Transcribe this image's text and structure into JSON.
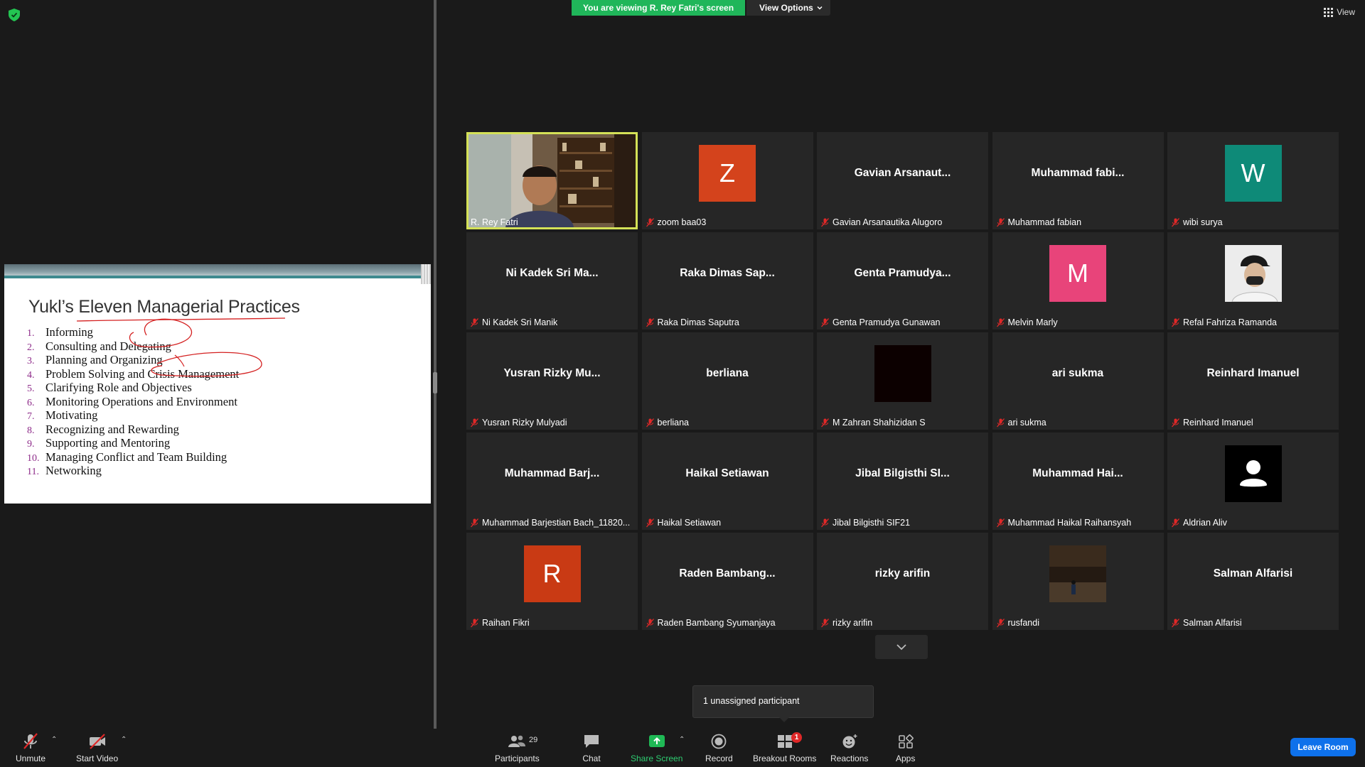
{
  "banner": {
    "viewing_text": "You are viewing R. Rey Fatri's screen",
    "view_options_label": "View Options"
  },
  "top_right": {
    "view_label": "View"
  },
  "slide": {
    "title": "Yukl’s Eleven Managerial Practices",
    "items": [
      {
        "num": "1.",
        "text": "Informing"
      },
      {
        "num": "2.",
        "text": "Consulting and Delegating"
      },
      {
        "num": "3.",
        "text": "Planning and Organizing"
      },
      {
        "num": "4.",
        "text": "Problem Solving and Crisis Management"
      },
      {
        "num": "5.",
        "text": "Clarifying Role and Objectives"
      },
      {
        "num": "6.",
        "text": "Monitoring Operations and Environment"
      },
      {
        "num": "7.",
        "text": "Motivating"
      },
      {
        "num": "8.",
        "text": "Recognizing and Rewarding"
      },
      {
        "num": "9.",
        "text": "Supporting and Mentoring"
      },
      {
        "num": "10.",
        "text": "Managing Conflict and Team Building"
      },
      {
        "num": "11.",
        "text": "Networking"
      }
    ]
  },
  "participants": [
    {
      "label": "R. Rey Fatri",
      "display": "",
      "kind": "video",
      "active": true
    },
    {
      "label": "zoom baa03",
      "display": "Z",
      "kind": "letter",
      "color": "#d4431c"
    },
    {
      "label": "Gavian Arsanautika Alugoro",
      "display": "Gavian  Arsanaut...",
      "kind": "name"
    },
    {
      "label": "Muhammad fabian",
      "display": "Muhammad  fabi...",
      "kind": "name"
    },
    {
      "label": "wibi surya",
      "display": "W",
      "kind": "letter",
      "color": "#0e8a78"
    },
    {
      "label": "Ni Kadek Sri Manik",
      "display": "Ni Kadek Sri Ma...",
      "kind": "name"
    },
    {
      "label": "Raka Dimas Saputra",
      "display": "Raka Dimas Sap...",
      "kind": "name"
    },
    {
      "label": "Genta Pramudya Gunawan",
      "display": "Genta  Pramudya...",
      "kind": "name"
    },
    {
      "label": "Melvin Marly",
      "display": "M",
      "kind": "letter",
      "color": "#e8447a"
    },
    {
      "label": "Refal Fahriza Ramanda",
      "display": "",
      "kind": "photo-cap"
    },
    {
      "label": "Yusran Rizky Mulyadi",
      "display": "Yusran Rizky Mu...",
      "kind": "name"
    },
    {
      "label": "berliana",
      "display": "berliana",
      "kind": "name"
    },
    {
      "label": "M Zahran Shahizidan S",
      "display": "",
      "kind": "blank"
    },
    {
      "label": "ari sukma",
      "display": "ari sukma",
      "kind": "name"
    },
    {
      "label": "Reinhard Imanuel",
      "display": "Reinhard Imanuel",
      "kind": "name"
    },
    {
      "label": "Muhammad Barjestian Bach_11820...",
      "display": "Muhammad  Barj...",
      "kind": "name"
    },
    {
      "label": "Haikal Setiawan",
      "display": "Haikal Setiawan",
      "kind": "name"
    },
    {
      "label": "Jibal Bilgisthi SIF21",
      "display": "Jibal Bilgisthi SI...",
      "kind": "name"
    },
    {
      "label": "Muhammad Haikal Raihansyah",
      "display": "Muhammad  Hai...",
      "kind": "name"
    },
    {
      "label": "Aldrian Aliv",
      "display": "",
      "kind": "default"
    },
    {
      "label": "Raihan Fikri",
      "display": "R",
      "kind": "letter",
      "color": "#c93a14"
    },
    {
      "label": "Raden Bambang Syumanjaya",
      "display": "Raden  Bambang...",
      "kind": "name"
    },
    {
      "label": "rizky arifin",
      "display": "rizky arifin",
      "kind": "name"
    },
    {
      "label": "rusfandi",
      "display": "",
      "kind": "photo-night"
    },
    {
      "label": "Salman Alfarisi",
      "display": "Salman Alfarisi",
      "kind": "name"
    }
  ],
  "tooltip": {
    "text": "1 unassigned participant"
  },
  "toolbar": {
    "unmute": "Unmute",
    "start_video": "Start Video",
    "participants": "Participants",
    "participants_count": "29",
    "chat": "Chat",
    "share_screen": "Share Screen",
    "record": "Record",
    "breakout_rooms": "Breakout Rooms",
    "breakout_badge": "1",
    "reactions": "Reactions",
    "apps": "Apps",
    "leave_room": "Leave Room"
  }
}
